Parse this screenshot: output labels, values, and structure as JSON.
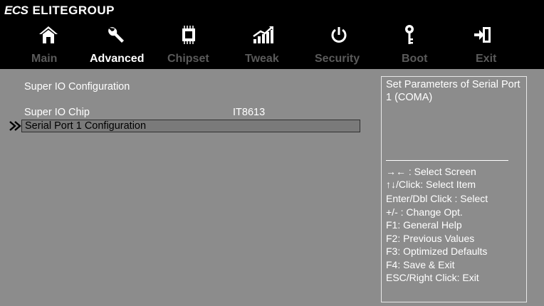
{
  "brand": {
    "logo": "ECS",
    "name": "ELITEGROUP"
  },
  "icons": [
    "home-icon",
    "wrench-icon",
    "chip-icon",
    "tweak-chart-icon",
    "power-icon",
    "key-icon",
    "exit-door-icon"
  ],
  "tabs": [
    "Main",
    "Advanced",
    "Chipset",
    "Tweak",
    "Security",
    "Boot",
    "Exit"
  ],
  "active_tab": "Advanced",
  "main": {
    "section_title": "Super IO Configuration",
    "chip_label": "Super IO Chip",
    "chip_value": "IT8613",
    "selected_item": "Serial  Port 1 Configuration"
  },
  "help": {
    "description": "Set Parameters of Serial Port 1 (COMA)",
    "keys": [
      "→←  : Select Screen",
      "↑↓/Click: Select Item",
      "Enter/Dbl Click : Select",
      "+/- : Change Opt.",
      "F1: General Help",
      "F2: Previous Values",
      "F3: Optimized Defaults",
      "F4: Save & Exit",
      "ESC/Right Click: Exit"
    ]
  },
  "colors": {
    "background": "#000000",
    "panel": "#8c8c8c",
    "highlight": "#7a7a7a",
    "inactive_tab": "#5a5a5a"
  }
}
